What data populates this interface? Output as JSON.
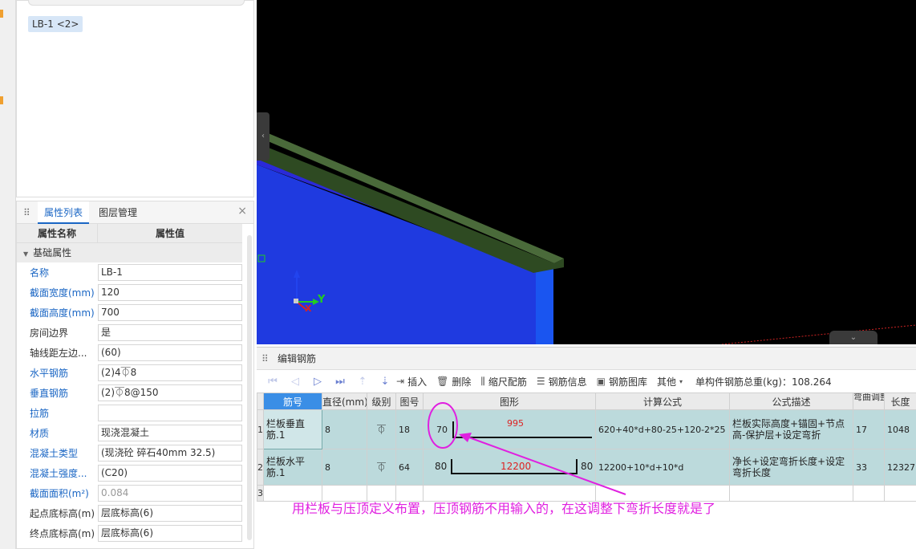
{
  "tree": {
    "selected_item": "LB-1 <2>"
  },
  "property_panel": {
    "tabs": [
      "属性列表",
      "图层管理"
    ],
    "header": {
      "name_col": "属性名称",
      "value_col": "属性值"
    },
    "group": "基础属性",
    "rows": [
      {
        "name": "名称",
        "value": "LB-1"
      },
      {
        "name": "截面宽度(mm)",
        "value": "120"
      },
      {
        "name": "截面高度(mm)",
        "value": "700"
      },
      {
        "name": "房间边界",
        "value": "是"
      },
      {
        "name": "轴线距左边...",
        "value": "(60)"
      },
      {
        "name": "水平钢筋",
        "value": "(2)4⏁8"
      },
      {
        "name": "垂直钢筋",
        "value": "(2)⏁8@150"
      },
      {
        "name": "拉筋",
        "value": ""
      },
      {
        "name": "材质",
        "value": "现浇混凝土"
      },
      {
        "name": "混凝土类型",
        "value": "(现浇砼 碎石40mm 32.5)"
      },
      {
        "name": "混凝土强度...",
        "value": "(C20)"
      },
      {
        "name": "截面面积(m²)",
        "value": "0.084"
      },
      {
        "name": "起点底标高(m)",
        "value": "层底标高(6)"
      },
      {
        "name": "终点底标高(m)",
        "value": "层底标高(6)"
      }
    ]
  },
  "viewport": {
    "axis_y": "Y",
    "axis_x": "X"
  },
  "rebar_editor": {
    "title": "编辑钢筋",
    "toolbar": {
      "insert": "插入",
      "delete": "删除",
      "scale": "缩尺配筋",
      "info": "钢筋信息",
      "library": "钢筋图库",
      "other": "其他",
      "total_weight": "单构件钢筋总重(kg)：108.264"
    },
    "columns": [
      "筋号",
      "直径(mm)",
      "级别",
      "图号",
      "图形",
      "计算公式",
      "公式描述",
      "弯曲调整",
      "长度"
    ],
    "rows": [
      {
        "index": "1",
        "name": "栏板垂直筋.1",
        "diameter": "8",
        "grade": "⏁",
        "fig_no": "18",
        "shape_left": "70",
        "shape_main": "995",
        "formula": "620+40*d+80-25+120-2*25",
        "description": "栏板实际高度+锚固+节点高-保护层+设定弯折",
        "bend": "17",
        "length": "1048"
      },
      {
        "index": "2",
        "name": "栏板水平筋.1",
        "diameter": "8",
        "grade": "⏁",
        "fig_no": "64",
        "shape_left": "80",
        "shape_main": "12200",
        "shape_right": "80",
        "formula": "12200+10*d+10*d",
        "description": "净长+设定弯折长度+设定弯折长度",
        "bend": "33",
        "length": "12327"
      },
      {
        "index": "3"
      }
    ]
  },
  "annotation": "用栏板与压顶定义布置，压顶钢筋不用输入的，在这调整下弯折长度就是了",
  "colors": {
    "accent": "#1a66c4",
    "annotation": "#e020e0",
    "row_bg": "#bcdadc",
    "shape_red": "#dd2222"
  }
}
